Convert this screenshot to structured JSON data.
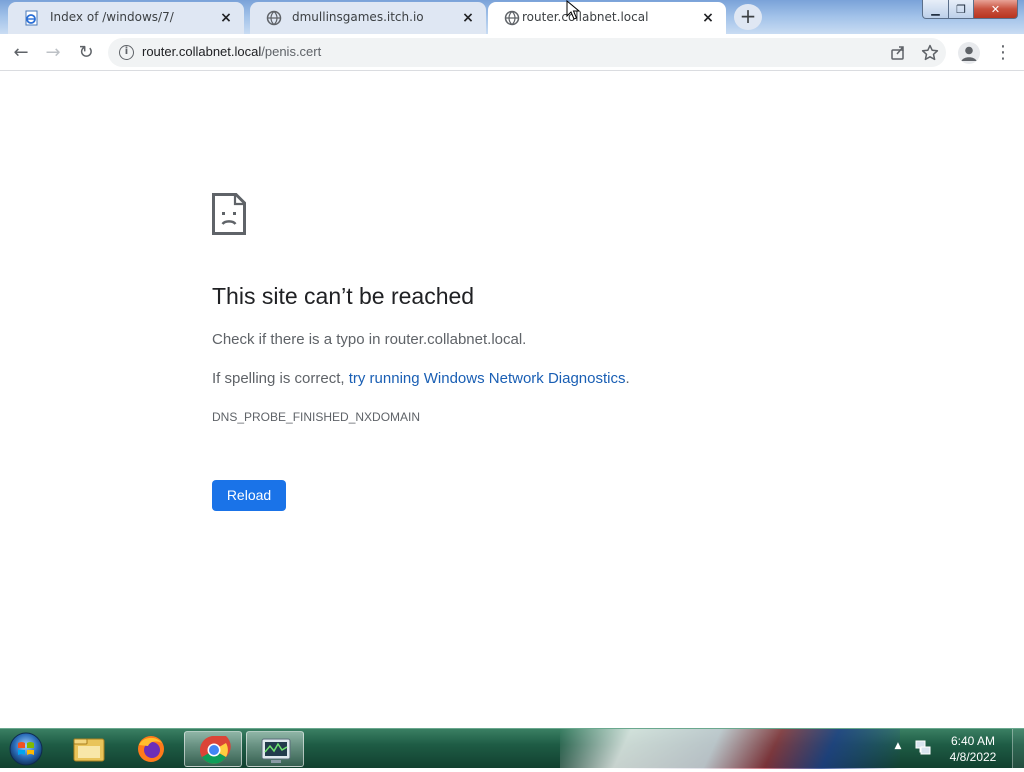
{
  "browser": {
    "tabs": [
      {
        "title": "Index of /windows/7/",
        "favicon": "ie-page-icon",
        "active": false
      },
      {
        "title": "dmullinsgames.itch.io",
        "favicon": "globe-icon",
        "active": false
      },
      {
        "title": "router.collabnet.local",
        "favicon": "globe-icon",
        "active": true
      }
    ],
    "new_tab_label": "+",
    "close_glyph": "×",
    "window_controls": {
      "minimize": "▁",
      "maximize": "❐",
      "close": "✕"
    },
    "toolbar": {
      "back": "←",
      "forward": "→",
      "reload": "↻",
      "url_host": "router.collabnet.local",
      "url_path": "/penis.cert",
      "menu": "⋮"
    }
  },
  "error_page": {
    "title": "This site can’t be reached",
    "line1": "Check if there is a typo in router.collabnet.local.",
    "line2_prefix": "If spelling is correct, ",
    "line2_link": "try running Windows Network Diagnostics",
    "line2_suffix": ".",
    "error_code": "DNS_PROBE_FINISHED_NXDOMAIN",
    "reload_label": "Reload"
  },
  "taskbar": {
    "apps": [
      {
        "name": "windows-explorer-icon",
        "active": false
      },
      {
        "name": "firefox-icon",
        "active": false
      },
      {
        "name": "chrome-icon",
        "active": true
      },
      {
        "name": "performance-monitor-icon",
        "active": true
      }
    ],
    "clock_time": "6:40 AM",
    "clock_date": "4/8/2022"
  },
  "colors": {
    "accent": "#1a73e8",
    "link": "#1a5fb4",
    "title_text": "#202124",
    "body_text": "#5f6368"
  }
}
